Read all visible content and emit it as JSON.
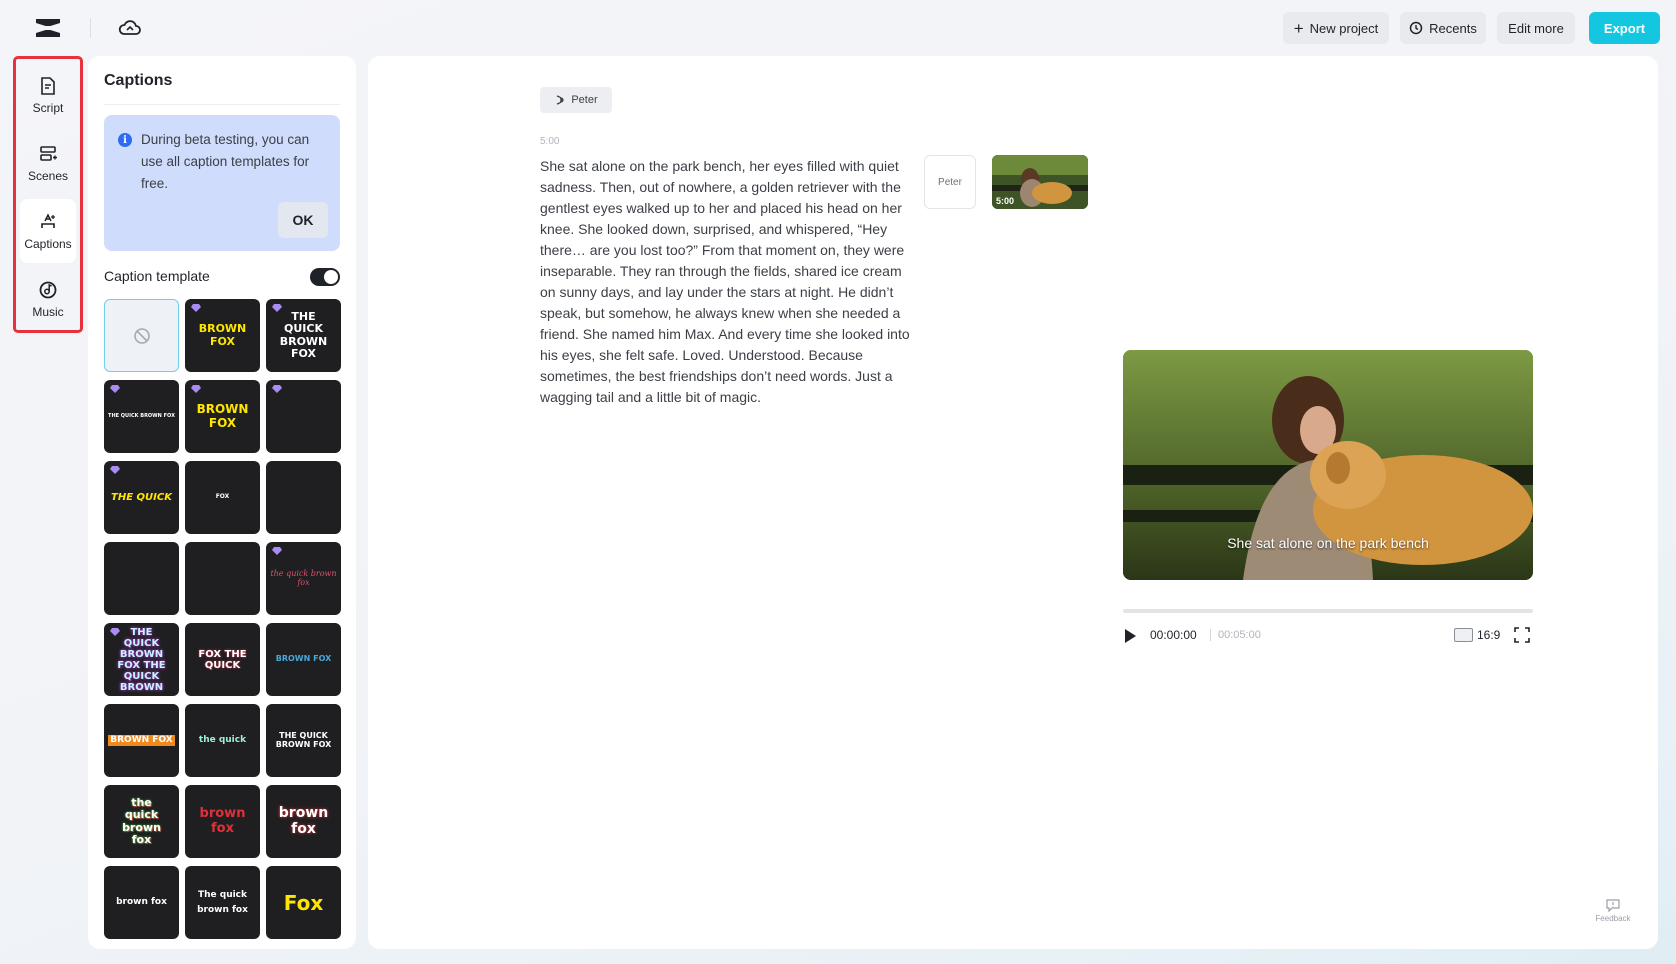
{
  "topbar": {
    "buttons": {
      "new_project": "New project",
      "recents": "Recents",
      "edit_more": "Edit more",
      "export": "Export"
    },
    "accent_color": "#14c6e0"
  },
  "sidebar": {
    "items": [
      {
        "label": "Script",
        "icon": "script-icon"
      },
      {
        "label": "Scenes",
        "icon": "scenes-icon"
      },
      {
        "label": "Captions",
        "icon": "captions-icon",
        "active": true
      },
      {
        "label": "Music",
        "icon": "music-icon"
      }
    ],
    "highlight_color": "#e8323b"
  },
  "captions_panel": {
    "title": "Captions",
    "beta_notice": "During beta testing, you can use all caption templates for free.",
    "ok_label": "OK",
    "template_label": "Caption template",
    "template_toggle_on": true,
    "templates": [
      {
        "text": "",
        "style": "none"
      },
      {
        "text": "BROWN FOX",
        "premium": true
      },
      {
        "text": "THE QUICK BROWN FOX",
        "premium": true
      },
      {
        "text": "THE QUICK BROWN FOX",
        "premium": true
      },
      {
        "text": "BROWN FOX",
        "premium": true
      },
      {
        "text": "",
        "premium": true
      },
      {
        "text": "THE QUICK",
        "premium": true
      },
      {
        "text": "FOX",
        "premium": false
      },
      {
        "text": "",
        "premium": false
      },
      {
        "text": "",
        "premium": false
      },
      {
        "text": "",
        "premium": false
      },
      {
        "text": "the quick brown fox",
        "premium": true
      },
      {
        "text": "THE QUICK BROWN FOX THE QUICK BROWN",
        "premium": true
      },
      {
        "text": "FOX THE QUICK",
        "premium": false
      },
      {
        "text": "BROWN FOX",
        "premium": false
      },
      {
        "text": "BROWN FOX",
        "premium": false
      },
      {
        "text": "the quick",
        "premium": false
      },
      {
        "text": "THE QUICK BROWN FOX",
        "premium": false
      },
      {
        "text": "the quick brown fox",
        "premium": false
      },
      {
        "text": "brown fox",
        "premium": false
      },
      {
        "text": "brown fox",
        "premium": false
      },
      {
        "text": "brown fox",
        "premium": false
      },
      {
        "text": "The quick brown fox",
        "premium": false
      },
      {
        "text": "Fox",
        "premium": false
      }
    ]
  },
  "script": {
    "speaker": "Peter",
    "time": "5:00",
    "text": "She sat alone on the park bench, her eyes filled with quiet sadness. Then, out of nowhere, a golden retriever with the gentlest eyes walked up to her and placed his head on her knee. She looked down, surprised, and whispered, “Hey there… are you lost too?” From that moment on, they were inseparable. They ran through the fields, shared ice cream on sunny days, and lay under the stars at night. He didn’t speak, but somehow, he always knew when she needed a friend. She named him Max. And every time she looked into his eyes, she felt safe. Loved. Understood. Because sometimes, the best friendships don’t need words. Just a wagging tail and a little bit of magic.",
    "avatar_label": "Peter",
    "scene_duration": "5:00"
  },
  "preview": {
    "subtitle": "She sat alone on the park bench",
    "current_time": "00:00:00",
    "total_time": "00:05:00",
    "progress": 0,
    "aspect_ratio": "16:9"
  },
  "feedback_label": "Feedback"
}
